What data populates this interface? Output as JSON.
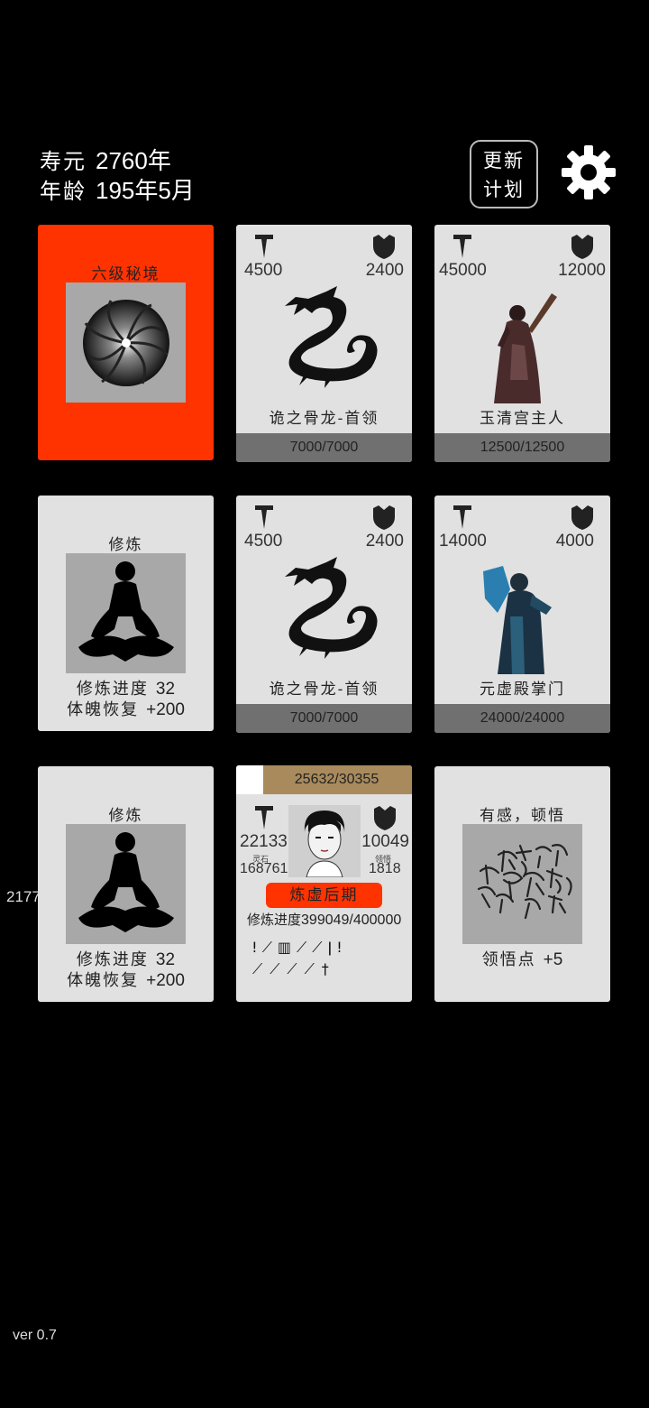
{
  "header": {
    "lifespan_label": "寿元",
    "lifespan_value": "2760年",
    "age_label": "年龄",
    "age_value": "195年5月",
    "update_button": "更新\n计划",
    "update_line1": "更新",
    "update_line2": "计划",
    "settings_icon": "gear-icon"
  },
  "cards": {
    "secret_realm": {
      "title": "六级秘境",
      "icon": "vortex-icon",
      "color": "#ff3300"
    },
    "enemy1": {
      "attack": "4500",
      "defense": "2400",
      "name": "诡之骨龙-首领",
      "hp": "7000/7000",
      "icon": "dragon-icon"
    },
    "enemy2": {
      "attack": "45000",
      "defense": "12000",
      "name": "玉清宫主人",
      "hp": "12500/12500",
      "icon": "warrior-icon"
    },
    "cultivate1": {
      "title": "修炼",
      "progress_label": "修炼进度",
      "progress_value": "32",
      "recover_label": "体魄恢复",
      "recover_value": "+200",
      "icon": "meditation-icon"
    },
    "enemy3": {
      "attack": "4500",
      "defense": "2400",
      "name": "诡之骨龙-首领",
      "hp": "7000/7000",
      "icon": "dragon-icon"
    },
    "enemy4": {
      "attack": "14000",
      "defense": "4000",
      "name": "元虚殿掌门",
      "hp": "24000/24000",
      "icon": "mage-icon"
    },
    "cultivate2": {
      "title": "修炼",
      "progress_label": "修炼进度",
      "progress_value": "32",
      "recover_label": "体魄恢复",
      "recover_value": "+200",
      "icon": "meditation-icon"
    },
    "player": {
      "exp": "25632/30355",
      "exp_fraction": 0.8444,
      "attack": "22133",
      "spirit_stone_label": "灵石",
      "spirit_stone": "168761",
      "defense": "10049",
      "insight_label": "领悟",
      "insight": "1818",
      "realm": "炼虚后期",
      "progress_label": "修炼进度",
      "progress_value": "399049/400000",
      "weapons_row1": "ǃ⟋▥⟋⟋ǀǃ",
      "weapons_row2": "⟋⟋⟋⟋†",
      "icon": "player-portrait"
    },
    "insight_card": {
      "title": "有感，顿悟",
      "reward_label": "领悟点",
      "reward_value": "+5",
      "icon": "calligraphy-icon"
    }
  },
  "side_number": "2177",
  "version": "ver 0.7"
}
